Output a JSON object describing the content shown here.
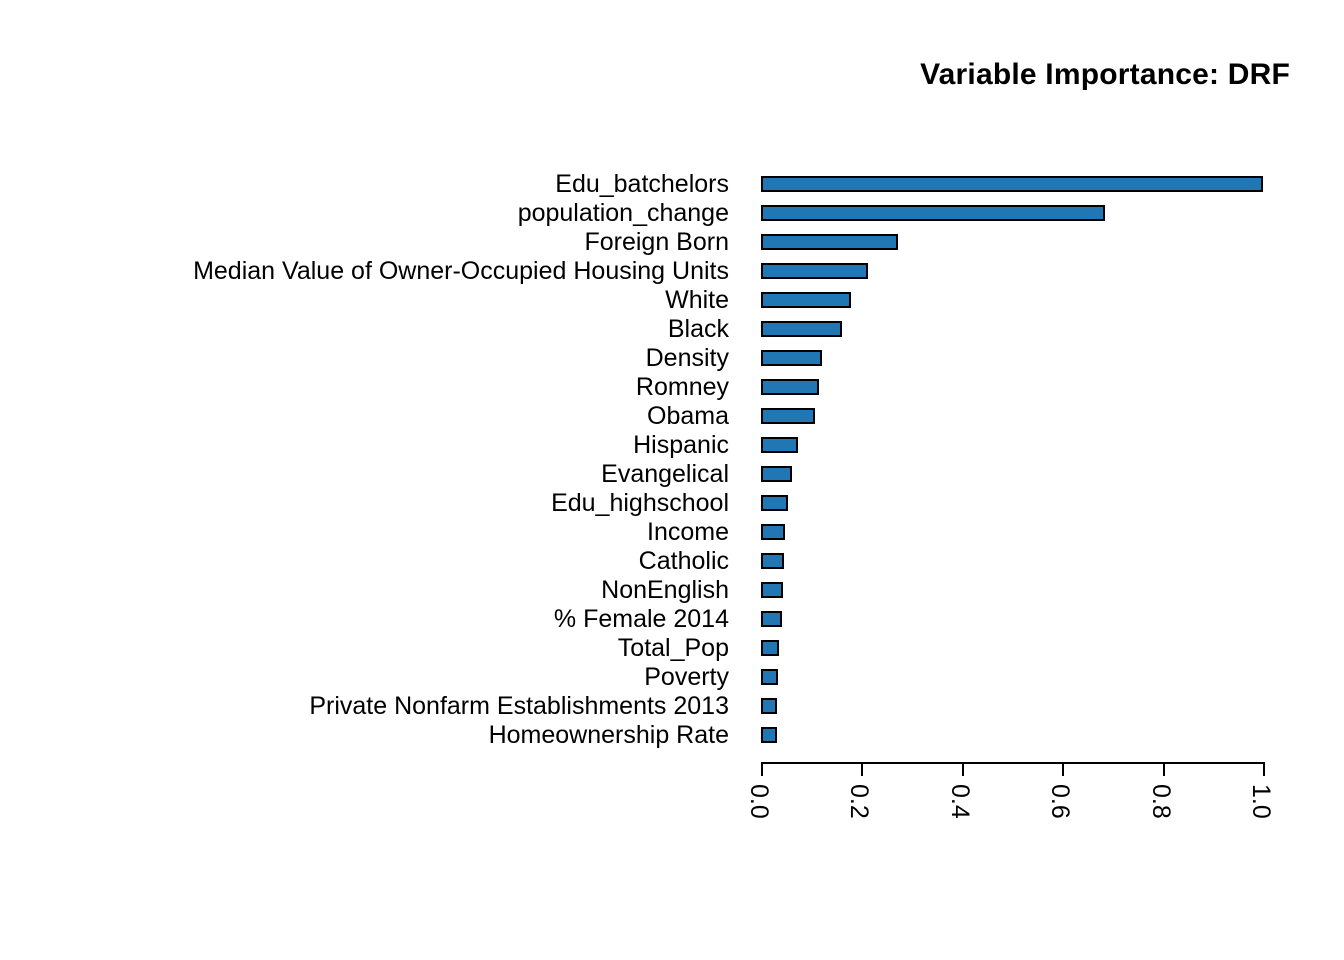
{
  "chart_data": {
    "type": "bar",
    "orientation": "horizontal",
    "title": "Variable Importance: DRF",
    "xlabel": "",
    "ylabel": "",
    "xlim": [
      0.0,
      1.0
    ],
    "grid": false,
    "legend": null,
    "bar_color": "#2077b4",
    "bar_border_color": "#000000",
    "background_color": "#ffffff",
    "xticks": [
      "0.0",
      "0.2",
      "0.4",
      "0.6",
      "0.8",
      "1.0"
    ],
    "xtick_values": [
      0.0,
      0.2,
      0.4,
      0.6,
      0.8,
      1.0
    ],
    "categories": [
      "Edu_batchelors",
      "population_change",
      "Foreign Born",
      "Median Value of Owner-Occupied Housing Units",
      "White",
      "Black",
      "Density",
      "Romney",
      "Obama",
      "Hispanic",
      "Evangelical",
      "Edu_highschool",
      "Income",
      "Catholic",
      "NonEnglish",
      "% Female 2014",
      "Total_Pop",
      "Poverty",
      "Private Nonfarm Establishments 2013",
      "Homeownership Rate"
    ],
    "values": [
      1.0,
      0.685,
      0.273,
      0.214,
      0.18,
      0.162,
      0.122,
      0.116,
      0.108,
      0.074,
      0.062,
      0.054,
      0.048,
      0.046,
      0.044,
      0.042,
      0.036,
      0.034,
      0.032,
      0.032
    ]
  }
}
